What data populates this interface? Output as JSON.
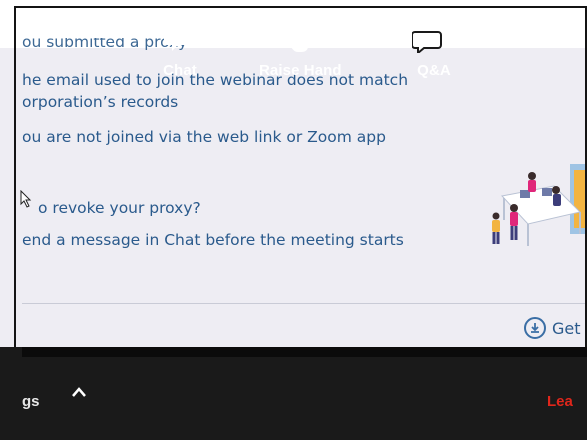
{
  "slide": {
    "lines": [
      "ou submitted a proxy",
      "he email used to join the webinar does not match",
      "orporation’s records",
      "ou are not joined via the web link or Zoom app",
      "o revoke your proxy?",
      "end a message in Chat before the meeting starts"
    ],
    "get_link_label": "Get",
    "get_link_icon": "document-download-icon",
    "illustration": "people-at-desk-illustration"
  },
  "toolbar": {
    "settings_fragment": "gs",
    "caret_icon": "chevron-up-icon",
    "items": [
      {
        "label": "Chat",
        "icon": "chat-bubble-icon"
      },
      {
        "label": "Raise Hand",
        "icon": "raise-hand-icon"
      },
      {
        "label": "Q&A",
        "icon": "qa-bubbles-icon"
      }
    ],
    "leave_fragment": "Lea"
  },
  "colors": {
    "slide_text": "#2a5a8c",
    "toolbar_bg": "#1a1a1a",
    "leave_red": "#e0261b"
  }
}
